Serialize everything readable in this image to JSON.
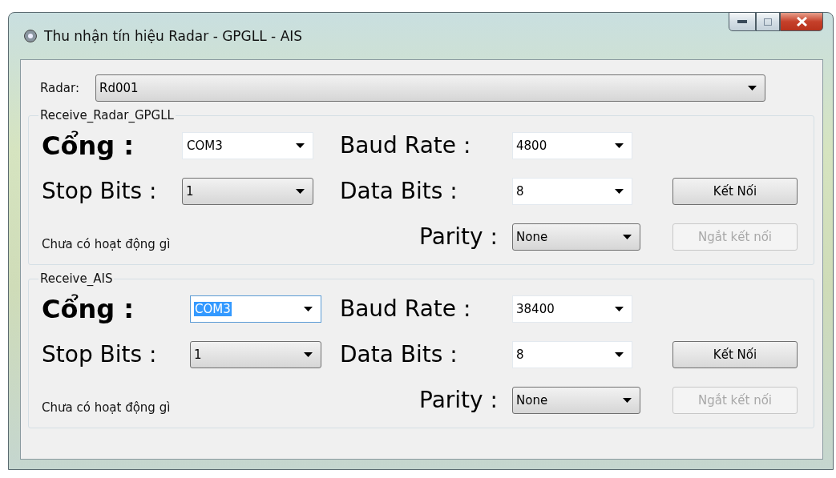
{
  "window": {
    "title": "Thu nhận tín hiệu Radar - GPGLL - AIS"
  },
  "radar": {
    "label": "Radar:",
    "value": "Rd001"
  },
  "sections": [
    {
      "title": "Receive_Radar_GPGLL",
      "port": {
        "label": "Cổng :",
        "value": "COM3",
        "kind": "editable",
        "selected": false
      },
      "baud": {
        "label": "Baud Rate :",
        "value": "4800",
        "kind": "editable"
      },
      "stop_bits": {
        "label": "Stop Bits :",
        "value": "1",
        "kind": "list"
      },
      "data_bits": {
        "label": "Data Bits :",
        "value": "8",
        "kind": "editable"
      },
      "parity": {
        "label": "Parity :",
        "value": "None",
        "kind": "list"
      },
      "status": "Chưa có hoạt động gì",
      "connect": {
        "label": "Kết Nối",
        "disabled": false
      },
      "disconnect": {
        "label": "Ngắt kết nối",
        "disabled": true
      }
    },
    {
      "title": "Receive_AIS",
      "port": {
        "label": "Cổng :",
        "value": "COM3",
        "kind": "editable",
        "selected": true
      },
      "baud": {
        "label": "Baud Rate :",
        "value": "38400",
        "kind": "editable"
      },
      "stop_bits": {
        "label": "Stop Bits :",
        "value": "1",
        "kind": "list"
      },
      "data_bits": {
        "label": "Data Bits :",
        "value": "8",
        "kind": "editable"
      },
      "parity": {
        "label": "Parity :",
        "value": "None",
        "kind": "list"
      },
      "status": "Chưa có hoạt động gì",
      "connect": {
        "label": "Kết Nối",
        "disabled": false
      },
      "disconnect": {
        "label": "Ngắt kết nối",
        "disabled": true
      }
    }
  ]
}
